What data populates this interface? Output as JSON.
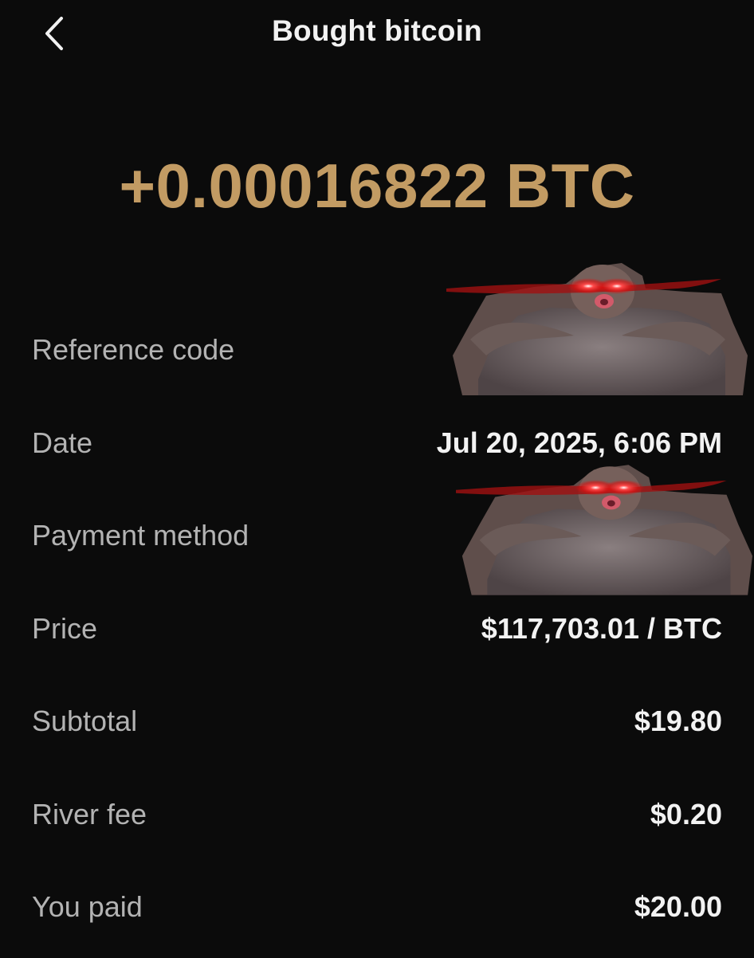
{
  "header": {
    "title": "Bought bitcoin",
    "back_icon": "chevron-left-icon"
  },
  "amount": "+0.00016822 BTC",
  "colors": {
    "background": "#0b0b0b",
    "accent_gold": "#c29b63",
    "label_gray": "#b3b3b3",
    "value_white": "#f2f2f2"
  },
  "details": {
    "reference_code": {
      "label": "Reference code"
    },
    "date": {
      "label": "Date",
      "value": "Jul 20, 2025, 6:06 PM"
    },
    "payment_method": {
      "label": "Payment method"
    },
    "price": {
      "label": "Price",
      "value": "$117,703.01 / BTC"
    },
    "subtotal": {
      "label": "Subtotal",
      "value": "$19.80"
    },
    "river_fee": {
      "label": "River fee",
      "value": "$0.20"
    },
    "you_paid": {
      "label": "You paid",
      "value": "$20.00"
    }
  },
  "overlays": [
    "meme-sticker-glowing-eyes",
    "meme-sticker-glowing-eyes"
  ]
}
